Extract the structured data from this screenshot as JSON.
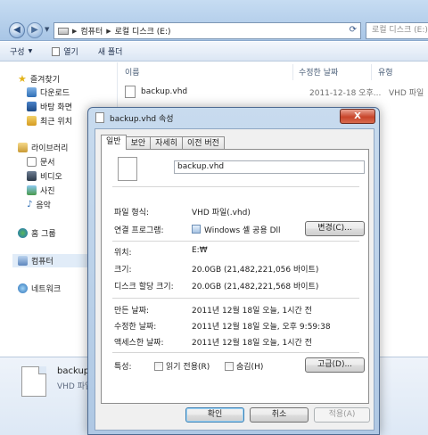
{
  "explorer": {
    "address": {
      "segments": [
        "컴퓨터",
        "로컬 디스크 (E:)"
      ]
    },
    "search": {
      "placeholder": "로컬 디스크 (E:) 검색"
    },
    "toolbar": {
      "organize": "구성",
      "open": "열기",
      "new_folder": "새 폴더"
    },
    "sidebar": {
      "favorites": "즐겨찾기",
      "downloads": "다운로드",
      "desktop": "바탕 화면",
      "recent": "최근 위치",
      "libraries": "라이브러리",
      "documents": "문서",
      "videos": "비디오",
      "pictures": "사진",
      "music": "음악",
      "homegroup": "홈 그룹",
      "computer": "컴퓨터",
      "network": "네트워크"
    },
    "columns": {
      "name": "이름",
      "modified": "수정한 날짜",
      "type": "유형"
    },
    "files": [
      {
        "name": "backup.vhd",
        "modified": "2011-12-18 오후...",
        "type": "VHD 파일"
      }
    ],
    "details": {
      "name": "backup.vhd",
      "type": "VHD 파일"
    }
  },
  "dialog": {
    "title": "backup.vhd 속성",
    "close_glyph": "X",
    "tabs": [
      "일반",
      "보안",
      "자세히",
      "이전 버전"
    ],
    "file_name": "backup.vhd",
    "labels": {
      "type": "파일 형식:",
      "opens_with": "연결 프로그램:",
      "location": "위치:",
      "size": "크기:",
      "size_on_disk": "디스크 할당 크기:",
      "created": "만든 날짜:",
      "modified": "수정한 날짜:",
      "accessed": "액세스한 날짜:",
      "attributes": "특성:"
    },
    "values": {
      "type": "VHD 파일(.vhd)",
      "opens_with": "Windows 셸 공용 Dll",
      "location": "E:₩",
      "size": "20.0GB (21,482,221,056 바이트)",
      "size_on_disk": "20.0GB (21,482,221,568 바이트)",
      "created": "2011년 12월 18일 오늘, 1시간 전",
      "modified": "2011년 12월 18일 오늘, 오후 9:59:38",
      "accessed": "2011년 12월 18일 오늘, 1시간 전"
    },
    "change_button": "변경(C)...",
    "readonly_checkbox": "읽기 전용(R)",
    "hidden_checkbox": "숨김(H)",
    "advanced_button": "고급(D)...",
    "ok_button": "확인",
    "cancel_button": "취소",
    "apply_button": "적용(A)"
  }
}
